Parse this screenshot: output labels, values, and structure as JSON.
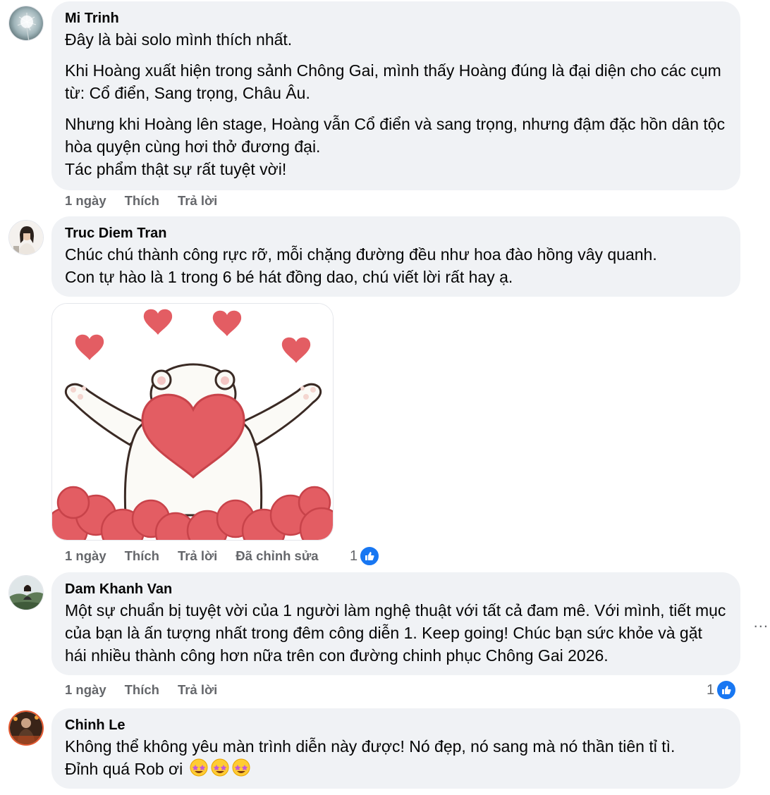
{
  "comments": [
    {
      "author": "Mi Trinh",
      "paragraphs": [
        "Đây là bài solo mình thích nhất.",
        "Khi Hoàng xuất hiện trong sảnh Chông Gai, mình thấy Hoàng đúng là đại diện cho các cụm từ: Cổ điển, Sang trọng, Châu Âu.",
        "Nhưng khi Hoàng lên stage, Hoàng vẫn Cổ điển và sang trọng, nhưng đậm đặc hồn dân tộc hòa quyện cùng hơi thở đương đại.\nTác phẩm thật sự rất tuyệt vời!"
      ],
      "time": "1 ngày",
      "like_label": "Thích",
      "reply_label": "Trả lời"
    },
    {
      "author": "Truc Diem Tran",
      "paragraphs": [
        "Chúc chú thành công rực rỡ, mỗi chặng đường đều như hoa đào hồng vây quanh.\nCon tự hào là 1 trong 6 bé hát đồng dao, chú viết lời rất hay ạ."
      ],
      "sticker": "polar-bear-hearts",
      "time": "1 ngày",
      "like_label": "Thích",
      "reply_label": "Trả lời",
      "edited_label": "Đã chỉnh sửa",
      "reaction_count": "1"
    },
    {
      "author": "Dam Khanh Van",
      "paragraphs": [
        "Một sự chuẩn bị tuyệt vời của 1 người làm nghệ thuật với tất cả đam mê. Với mình, tiết mục của bạn là ấn tượng nhất trong đêm công diễn 1. Keep going! Chúc bạn sức khỏe và gặt hái nhiều thành công hơn nữa trên con đường chinh phục Chông Gai 2026."
      ],
      "time": "1 ngày",
      "like_label": "Thích",
      "reply_label": "Trả lời",
      "reaction_count": "1"
    },
    {
      "author": "Chinh Le",
      "paragraphs": [
        "Không thể không yêu màn trình diễn này được! Nó đẹp, nó sang mà nó thần tiên tỉ tì."
      ],
      "last_line": "Đỉnh quá Rob ơi",
      "emoji": "star-struck"
    }
  ],
  "more_button": "...",
  "colors": {
    "bubble": "#f0f2f5",
    "meta": "#65676b",
    "like": "#1877f2",
    "heart": "#e35d63"
  }
}
